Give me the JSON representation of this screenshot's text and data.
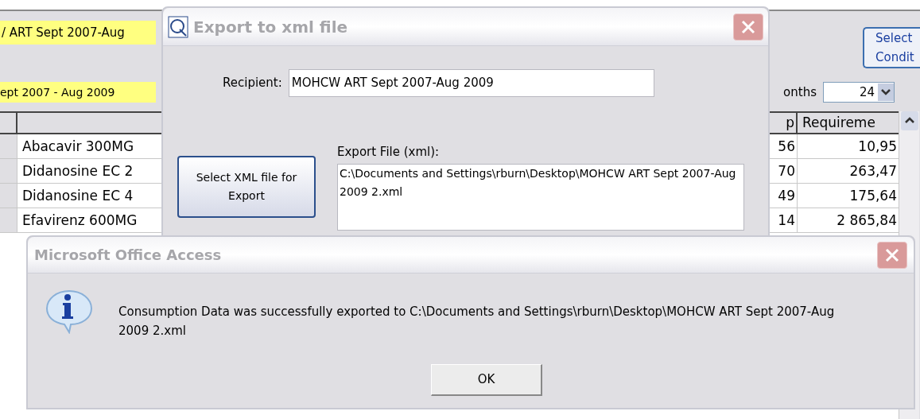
{
  "form": {
    "fields": [
      "/ ART Sept 2007-Aug",
      "ept 2007 - Aug 2009"
    ],
    "select_button": "Select Condit",
    "months_label": "onths",
    "months_value": "24",
    "table": {
      "columns": [
        "p",
        "Requireme"
      ],
      "rows": [
        {
          "name": "Abacavir 300MG",
          "column_2": "56",
          "requirement": "10,95"
        },
        {
          "name": "Didanosine EC 2",
          "column_2": "70",
          "requirement": "263,47"
        },
        {
          "name": "Didanosine EC 4",
          "column_2": "49",
          "requirement": "175,64"
        },
        {
          "name": "Efavirenz 600MG",
          "column_2": "14",
          "requirement": "2 865,84"
        }
      ]
    }
  },
  "export_dialog": {
    "title": "Export to xml file",
    "recipient_label": "Recipient:",
    "recipient_value": "MOHCW ART Sept 2007-Aug 2009",
    "select_button": "Select XML file for Export",
    "file_label": "Export File (xml):",
    "file_value": "C:\\Documents and Settings\\rburn\\Desktop\\MOHCW ART Sept 2007-Aug 2009 2.xml"
  },
  "message_box": {
    "title": "Microsoft Office Access",
    "message": "Consumption Data was successfully exported to C:\\Documents and Settings\\rburn\\Desktop\\MOHCW ART Sept 2007-Aug 2009 2.xml",
    "button": "OK"
  }
}
